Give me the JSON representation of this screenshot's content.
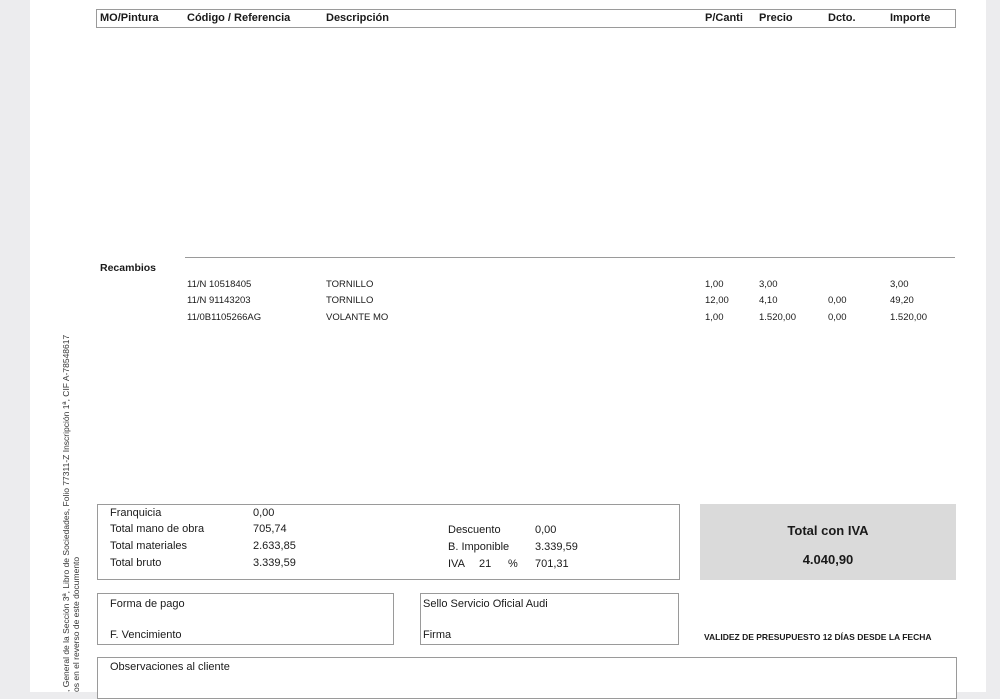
{
  "side_text": {
    "line1": ", General de la Sección 3ª, Libro de Sociedades, Folio 77311-Z Inscripción 1ª, CIF A-78548617",
    "line2": "os en el reverso de este documento"
  },
  "table_header": {
    "mo_pintura": "MO/Pintura",
    "codigo": "Código / Referencia",
    "descripcion": "Descripción",
    "pcanti": "P/Canti",
    "precio": "Precio",
    "dcto": "Dcto.",
    "importe": "Importe"
  },
  "recambios": {
    "title": "Recambios",
    "rows": [
      {
        "codigo": "11/N 10518405",
        "descripcion": "TORNILLO",
        "cantidad": "1,00",
        "precio": "3,00",
        "dcto": "",
        "importe": "3,00"
      },
      {
        "codigo": "11/N 91143203",
        "descripcion": "TORNILLO",
        "cantidad": "12,00",
        "precio": "4,10",
        "dcto": "0,00",
        "importe": "49,20"
      },
      {
        "codigo": "11/0B1105266AG",
        "descripcion": "VOLANTE MO",
        "cantidad": "1,00",
        "precio": "1.520,00",
        "dcto": "0,00",
        "importe": "1.520,00"
      }
    ]
  },
  "summary": {
    "franquicia_label": "Franquicia",
    "franquicia_value": "0,00",
    "mano_obra_label": "Total mano de obra",
    "mano_obra_value": "705,74",
    "materiales_label": "Total materiales",
    "materiales_value": "2.633,85",
    "bruto_label": "Total bruto",
    "bruto_value": "3.339,59",
    "descuento_label": "Descuento",
    "descuento_value": "0,00",
    "imponible_label": "B. Imponible",
    "imponible_value": "3.339,59",
    "iva_label": "IVA",
    "iva_rate": "21",
    "iva_pct": "%",
    "iva_value": "701,31"
  },
  "total": {
    "title": "Total con IVA",
    "value": "4.040,90"
  },
  "payment": {
    "forma_pago": "Forma de pago",
    "vencimiento": "F. Vencimiento"
  },
  "stamp": {
    "sello": "Sello Servicio Oficial Audi",
    "firma": "Firma"
  },
  "validity": "VALIDEZ DE PRESUPUESTO 12 DÍAS DESDE LA FECHA",
  "observaciones": "Observaciones al cliente"
}
